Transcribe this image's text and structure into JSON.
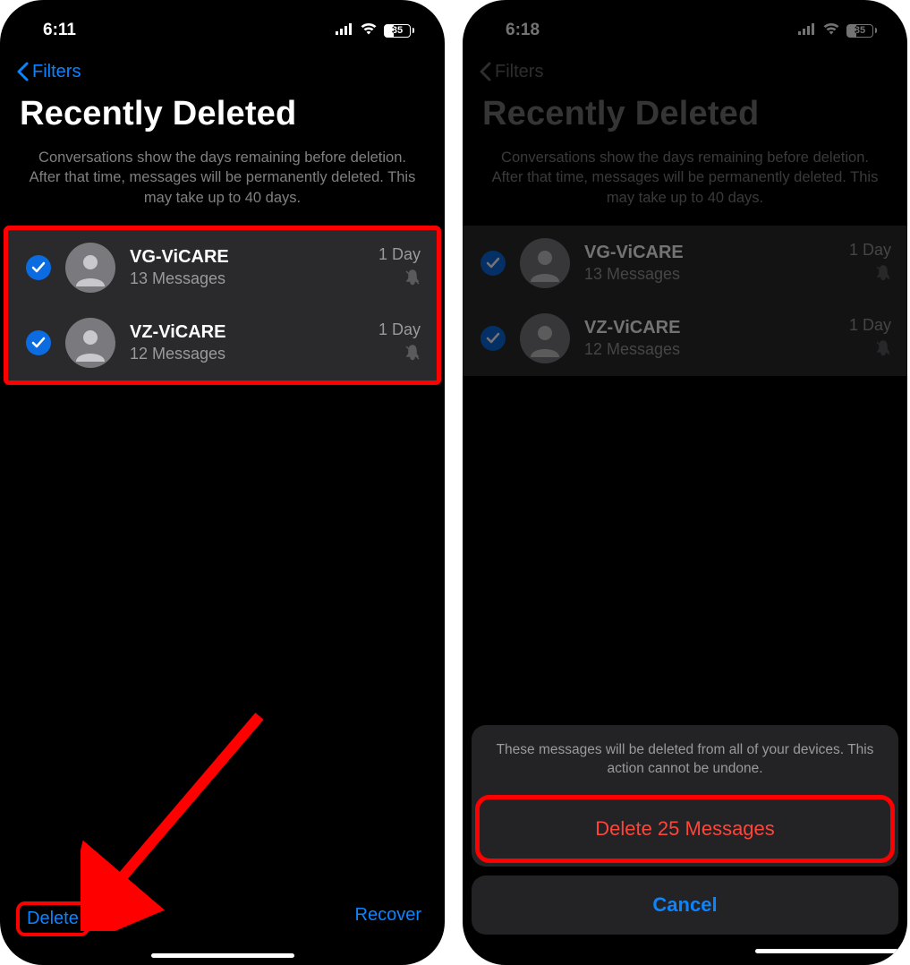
{
  "left": {
    "status": {
      "time": "6:11",
      "battery": "35"
    },
    "nav": {
      "back_label": "Filters"
    },
    "title": "Recently Deleted",
    "subtitle": "Conversations show the days remaining before deletion. After that time, messages will be permanently deleted. This may take up to 40 days.",
    "conversations": [
      {
        "name": "VG-ViCARE",
        "sub": "13 Messages",
        "days": "1 Day",
        "selected": true,
        "muted": true
      },
      {
        "name": "VZ-ViCARE",
        "sub": "12 Messages",
        "days": "1 Day",
        "selected": true,
        "muted": true
      }
    ],
    "toolbar": {
      "delete": "Delete",
      "recover": "Recover"
    }
  },
  "right": {
    "status": {
      "time": "6:18",
      "battery": "35"
    },
    "nav": {
      "back_label": "Filters"
    },
    "title": "Recently Deleted",
    "subtitle": "Conversations show the days remaining before deletion. After that time, messages will be permanently deleted. This may take up to 40 days.",
    "conversations": [
      {
        "name": "VG-ViCARE",
        "sub": "13 Messages",
        "days": "1 Day",
        "selected": true,
        "muted": true
      },
      {
        "name": "VZ-ViCARE",
        "sub": "12 Messages",
        "days": "1 Day",
        "selected": true,
        "muted": true
      }
    ],
    "sheet": {
      "message": "These messages will be deleted from all of your devices. This action cannot be undone.",
      "delete_label": "Delete 25 Messages",
      "cancel_label": "Cancel"
    }
  },
  "colors": {
    "accent": "#0b84ff",
    "destructive": "#ff453a",
    "highlight": "#ff0000"
  }
}
